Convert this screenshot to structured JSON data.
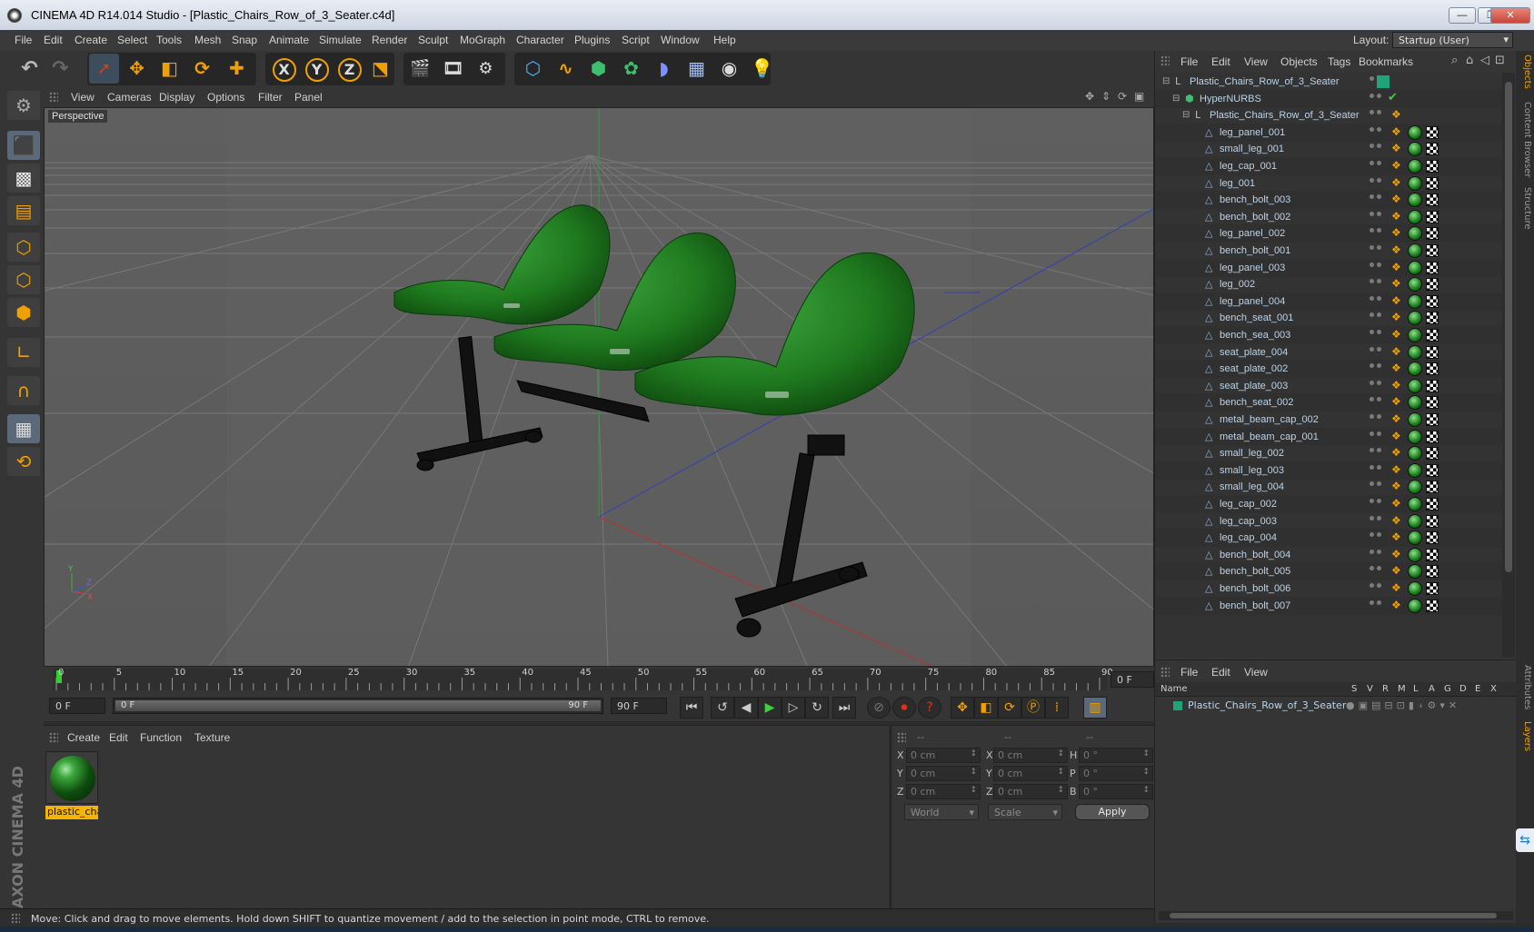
{
  "window": {
    "title": "CINEMA 4D R14.014 Studio - [Plastic_Chairs_Row_of_3_Seater.c4d]",
    "minimize": "—",
    "maximize": "❐",
    "close": "✕"
  },
  "menubar": {
    "items": [
      "File",
      "Edit",
      "Create",
      "Select",
      "Tools",
      "Mesh",
      "Snap",
      "Animate",
      "Simulate",
      "Render",
      "Sculpt",
      "MoGraph",
      "Character",
      "Plugins",
      "Script",
      "Window",
      "Help"
    ],
    "layout_label": "Layout:",
    "layout_value": "Startup (User)"
  },
  "toolbar": {
    "icons": [
      "undo-icon",
      "redo-icon",
      "select-arrow-icon",
      "move-icon",
      "scale-icon",
      "rotate-icon",
      "add-object-icon",
      "x-axis-lock-icon",
      "y-axis-lock-icon",
      "z-axis-lock-icon",
      "coordinate-system-icon",
      "render-view-icon",
      "render-to-picture-viewer-icon",
      "render-settings-icon",
      "cube-primitive-icon",
      "spline-icon",
      "nurbs-icon",
      "array-icon",
      "deformer-icon",
      "floor-icon",
      "camera-icon",
      "light-icon"
    ],
    "axis_labels": [
      "X",
      "Y",
      "Z"
    ]
  },
  "viewport": {
    "menu": [
      "View",
      "Cameras",
      "Display",
      "Options",
      "Filter",
      "Panel"
    ],
    "label": "Perspective",
    "axis_labels": {
      "x": "X",
      "y": "Y",
      "z": "Z"
    },
    "colors": {
      "chair": "#1f7a1f",
      "frame": "#111111",
      "grid": "#6a6a6a",
      "axis_x": "#c03030",
      "axis_y": "#30a030",
      "axis_z": "#3040c0"
    }
  },
  "timeline": {
    "ticks": [
      "0",
      "5",
      "10",
      "15",
      "20",
      "25",
      "30",
      "35",
      "40",
      "45",
      "50",
      "55",
      "60",
      "65",
      "70",
      "75",
      "80",
      "85",
      "90"
    ],
    "current_frame_field": "0 F"
  },
  "transport": {
    "start_field": "0 F",
    "range_start": "0 F",
    "range_end": "90 F",
    "end_field": "90 F"
  },
  "material_manager": {
    "menu": [
      "Create",
      "Edit",
      "Function",
      "Texture"
    ],
    "materials": [
      {
        "name": "plastic_cha"
      }
    ]
  },
  "coordinates": {
    "headers": [
      "--",
      "--",
      "--"
    ],
    "rows": [
      {
        "l1": "X",
        "v1": "0 cm",
        "l2": "X",
        "v2": "0 cm",
        "l3": "H",
        "v3": "0 °"
      },
      {
        "l1": "Y",
        "v1": "0 cm",
        "l2": "Y",
        "v2": "0 cm",
        "l3": "P",
        "v3": "0 °"
      },
      {
        "l1": "Z",
        "v1": "0 cm",
        "l2": "Z",
        "v2": "0 cm",
        "l3": "B",
        "v3": "0 °"
      }
    ],
    "mode": "World",
    "transform": "Scale",
    "apply": "Apply"
  },
  "status": "Move: Click and drag to move elements. Hold down SHIFT to quantize movement / add to the selection in point mode, CTRL to remove.",
  "object_manager": {
    "menu": [
      "File",
      "Edit",
      "View",
      "Objects",
      "Tags",
      "Bookmarks"
    ],
    "objects": [
      {
        "name": "Plastic_Chairs_Row_of_3_Seater",
        "level": 0,
        "kind": "null"
      },
      {
        "name": "HyperNURBS",
        "level": 1,
        "kind": "nurbs"
      },
      {
        "name": "Plastic_Chairs_Row_of_3_Seater",
        "level": 2,
        "kind": "null"
      },
      {
        "name": "leg_panel_001",
        "level": 3,
        "kind": "mesh"
      },
      {
        "name": "small_leg_001",
        "level": 3,
        "kind": "mesh"
      },
      {
        "name": "leg_cap_001",
        "level": 3,
        "kind": "mesh"
      },
      {
        "name": "leg_001",
        "level": 3,
        "kind": "mesh"
      },
      {
        "name": "bench_bolt_003",
        "level": 3,
        "kind": "mesh"
      },
      {
        "name": "bench_bolt_002",
        "level": 3,
        "kind": "mesh"
      },
      {
        "name": "leg_panel_002",
        "level": 3,
        "kind": "mesh"
      },
      {
        "name": "bench_bolt_001",
        "level": 3,
        "kind": "mesh"
      },
      {
        "name": "leg_panel_003",
        "level": 3,
        "kind": "mesh"
      },
      {
        "name": "leg_002",
        "level": 3,
        "kind": "mesh"
      },
      {
        "name": "leg_panel_004",
        "level": 3,
        "kind": "mesh"
      },
      {
        "name": "bench_seat_001",
        "level": 3,
        "kind": "mesh"
      },
      {
        "name": "bench_sea_003",
        "level": 3,
        "kind": "mesh"
      },
      {
        "name": "seat_plate_004",
        "level": 3,
        "kind": "mesh"
      },
      {
        "name": "seat_plate_002",
        "level": 3,
        "kind": "mesh"
      },
      {
        "name": "seat_plate_003",
        "level": 3,
        "kind": "mesh"
      },
      {
        "name": "bench_seat_002",
        "level": 3,
        "kind": "mesh"
      },
      {
        "name": "metal_beam_cap_002",
        "level": 3,
        "kind": "mesh"
      },
      {
        "name": "metal_beam_cap_001",
        "level": 3,
        "kind": "mesh"
      },
      {
        "name": "small_leg_002",
        "level": 3,
        "kind": "mesh"
      },
      {
        "name": "small_leg_003",
        "level": 3,
        "kind": "mesh"
      },
      {
        "name": "small_leg_004",
        "level": 3,
        "kind": "mesh"
      },
      {
        "name": "leg_cap_002",
        "level": 3,
        "kind": "mesh"
      },
      {
        "name": "leg_cap_003",
        "level": 3,
        "kind": "mesh"
      },
      {
        "name": "leg_cap_004",
        "level": 3,
        "kind": "mesh"
      },
      {
        "name": "bench_bolt_004",
        "level": 3,
        "kind": "mesh"
      },
      {
        "name": "bench_bolt_005",
        "level": 3,
        "kind": "mesh"
      },
      {
        "name": "bench_bolt_006",
        "level": 3,
        "kind": "mesh"
      },
      {
        "name": "bench_bolt_007",
        "level": 3,
        "kind": "mesh"
      }
    ]
  },
  "side_tabs": [
    "Objects",
    "Content Browser",
    "Structure",
    "Attributes",
    "Layers"
  ],
  "layer_manager": {
    "menu": [
      "File",
      "Edit",
      "View"
    ],
    "columns": [
      "Name",
      "S",
      "V",
      "R",
      "M",
      "L",
      "A",
      "G",
      "D",
      "E",
      "X"
    ],
    "layers": [
      {
        "name": "Plastic_Chairs_Row_of_3_Seater",
        "color": "#1fa37a"
      }
    ]
  },
  "brand": "MAXON CINEMA 4D"
}
